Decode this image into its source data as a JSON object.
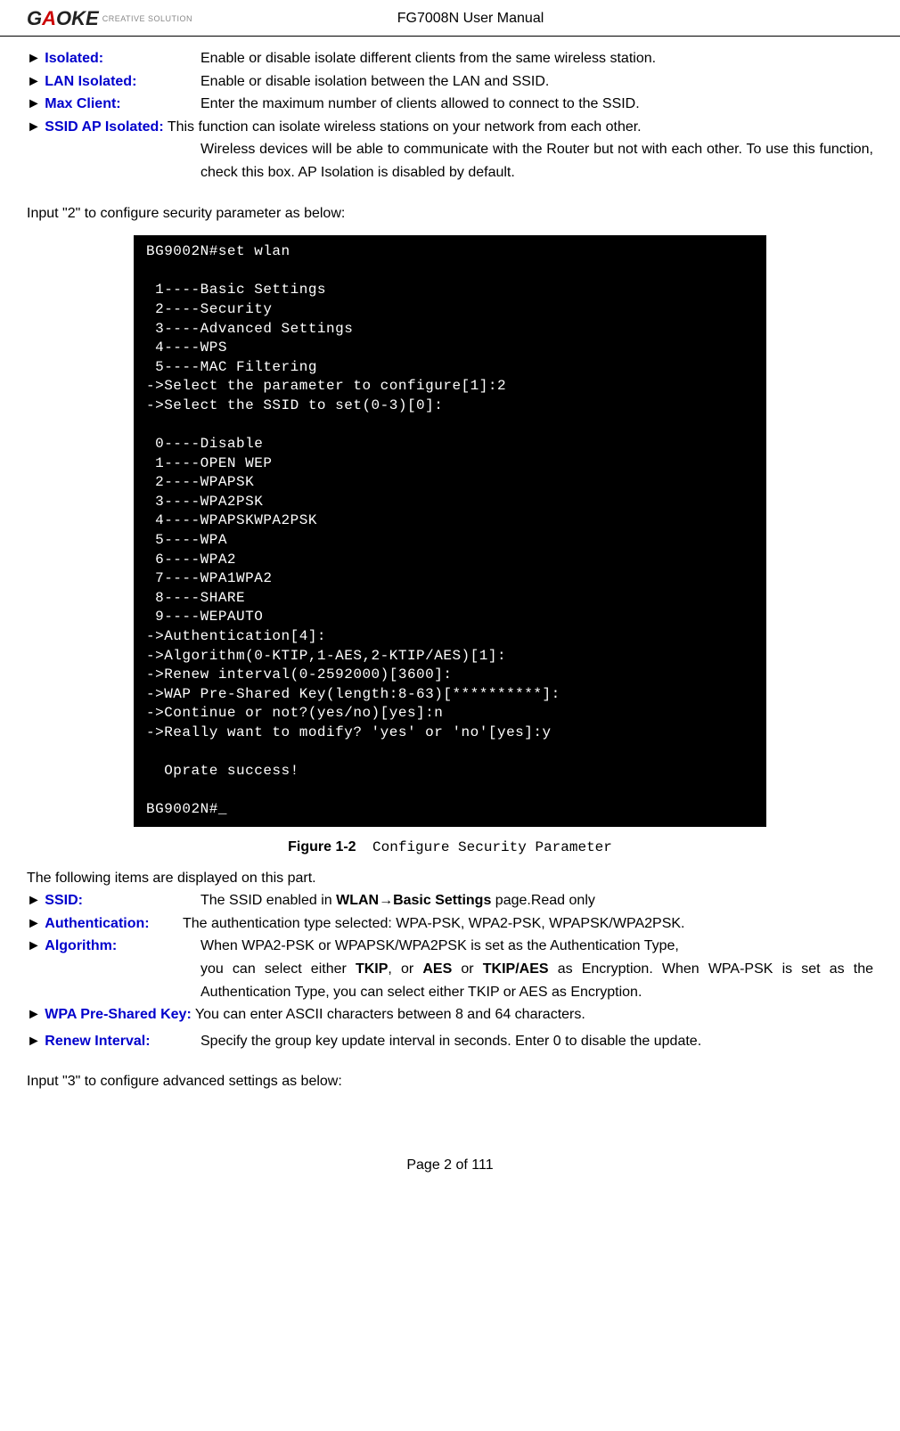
{
  "header": {
    "logo_name": "GAOKE",
    "tagline": "CREATIVE SOLUTION",
    "title": "FG7008N User Manual"
  },
  "defs_top": [
    {
      "term": "Isolated:",
      "text": "Enable or disable isolate different clients from the same wireless station."
    },
    {
      "term": "LAN Isolated:",
      "text": "Enable or disable isolation between the LAN and SSID."
    },
    {
      "term": "Max Client:",
      "text": "Enter the maximum number of clients allowed to connect to the SSID."
    },
    {
      "term": "SSID AP Isolated:",
      "text": "This function can isolate wireless stations on your network from each other. Wireless devices will be able to communicate with the Router but not with each other. To use this function, check this box. AP Isolation is disabled by default."
    }
  ],
  "para_input2": "Input \"2\" to configure security parameter as below:",
  "terminal": "BG9002N#set wlan\n\n 1----Basic Settings\n 2----Security\n 3----Advanced Settings\n 4----WPS\n 5----MAC Filtering\n->Select the parameter to configure[1]:2\n->Select the SSID to set(0-3)[0]:\n\n 0----Disable\n 1----OPEN WEP\n 2----WPAPSK\n 3----WPA2PSK\n 4----WPAPSKWPA2PSK\n 5----WPA\n 6----WPA2\n 7----WPA1WPA2\n 8----SHARE\n 9----WEPAUTO\n->Authentication[4]:\n->Algorithm(0-KTIP,1-AES,2-KTIP/AES)[1]:\n->Renew interval(0-2592000)[3600]:\n->WAP Pre-Shared Key(length:8-63)[**********]:\n->Continue or not?(yes/no)[yes]:n\n->Really want to modify? 'yes' or 'no'[yes]:y\n\n  Oprate success!\n\nBG9002N#_",
  "figure": {
    "label": "Figure 1-2",
    "title": "Configure Security Parameter"
  },
  "following_text": "The following items are displayed on this part.",
  "defs_bottom": {
    "ssid": {
      "term": "SSID:",
      "pre": "The SSID enabled in ",
      "bold1": "WLAN",
      "arrow": "→",
      "bold2": "Basic Settings",
      "post": " page.Read only"
    },
    "auth": {
      "term": "Authentication:",
      "text": "The authentication type selected: WPA-PSK, WPA2-PSK, WPAPSK/WPA2PSK."
    },
    "algo": {
      "term": "Algorithm:",
      "pre": "When WPA2-PSK or WPAPSK/WPA2PSK is set as the Authentication Type, you can select either ",
      "b1": "TKIP",
      "mid1": ", or ",
      "b2": "AES",
      "mid2": " or ",
      "b3": "TKIP/AES",
      "post": " as Encryption. When WPA-PSK is set as the Authentication Type, you can select either TKIP or AES as Encryption."
    },
    "wpa": {
      "term": "WPA Pre-Shared Key:",
      "text": " You can enter ASCII characters between 8 and 64 characters."
    },
    "renew": {
      "term": "Renew Interval:",
      "text": "Specify the group key update interval in seconds. Enter 0 to disable the update."
    }
  },
  "para_input3": "Input \"3\" to configure advanced settings as below:",
  "footer": "Page 2 of 111"
}
